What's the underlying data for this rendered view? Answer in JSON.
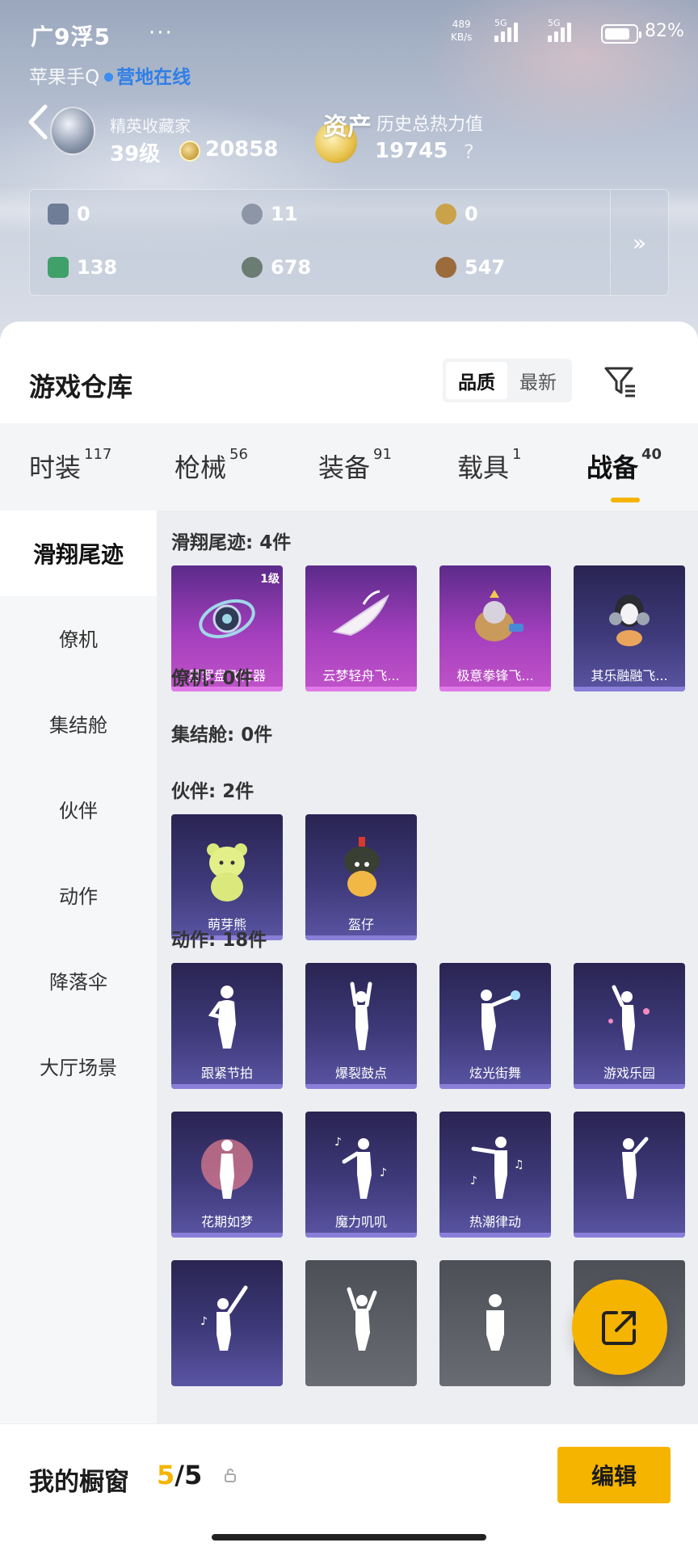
{
  "status_bar": {
    "carrier": "广9浮5",
    "netspeed_value": "489",
    "netspeed_unit": "KB/s",
    "sig1_label": "5G",
    "sig2_label": "5G",
    "battery_pct": "82%",
    "battery_level": 0.82
  },
  "profile": {
    "account_line": "苹果手Q",
    "online_status": "营地在线",
    "rank_title": "精英收藏家",
    "rank_level": "39级",
    "coins": "20858",
    "assets_label": "资产",
    "heat_label": "历史总热力值",
    "heat_value": "19745",
    "help": "?"
  },
  "stats": [
    {
      "value": "0",
      "icon": "card-icon",
      "color": "#6f7d97"
    },
    {
      "value": "11",
      "icon": "silver-token-icon",
      "color": "#8c96a6"
    },
    {
      "value": "0",
      "icon": "gold-token-icon",
      "color": "#c9a24a"
    },
    {
      "value": "138",
      "icon": "green-ticket-icon",
      "color": "#3fa06a"
    },
    {
      "value": "678",
      "icon": "orb-icon",
      "color": "#6b7c72"
    },
    {
      "value": "547",
      "icon": "bronze-token-icon",
      "color": "#9b6b3c"
    }
  ],
  "stats_more": "»",
  "warehouse": {
    "title": "游戏仓库",
    "sort_quality": "品质",
    "sort_newest": "最新"
  },
  "tabs": [
    {
      "label": "时装",
      "count": "117"
    },
    {
      "label": "枪械",
      "count": "56"
    },
    {
      "label": "装备",
      "count": "91"
    },
    {
      "label": "载具",
      "count": "1"
    },
    {
      "label": "战备",
      "count": "40"
    }
  ],
  "side_nav": [
    "滑翔尾迹",
    "僚机",
    "集结舱",
    "伙伴",
    "动作",
    "降落伞",
    "大厅场景"
  ],
  "groups": {
    "glide_title": "滑翔尾迹: 4件",
    "wingman_title": "僚机: 0件",
    "capsule_title": "集结舱: 0件",
    "partner_title": "伙伴: 2件",
    "action_title": "动作: 18件"
  },
  "glide_items": [
    {
      "name": "星罗盘飞行器",
      "level": "1级"
    },
    {
      "name": "云梦轻舟飞..."
    },
    {
      "name": "极意拳锋飞..."
    },
    {
      "name": "其乐融融飞..."
    }
  ],
  "partner_items": [
    {
      "name": "萌芽熊"
    },
    {
      "name": "盔仔"
    }
  ],
  "action_items": [
    {
      "name": "跟紧节拍"
    },
    {
      "name": "爆裂鼓点"
    },
    {
      "name": "炫光街舞"
    },
    {
      "name": "游戏乐园"
    },
    {
      "name": "花期如梦"
    },
    {
      "name": "魔力叽叽"
    },
    {
      "name": "热潮律动"
    }
  ],
  "footer": {
    "title": "我的橱窗",
    "current": "5",
    "sep": "/",
    "max": "5",
    "edit": "编辑"
  },
  "colors": {
    "accent": "#f5b400",
    "online": "#2f7fe6"
  }
}
